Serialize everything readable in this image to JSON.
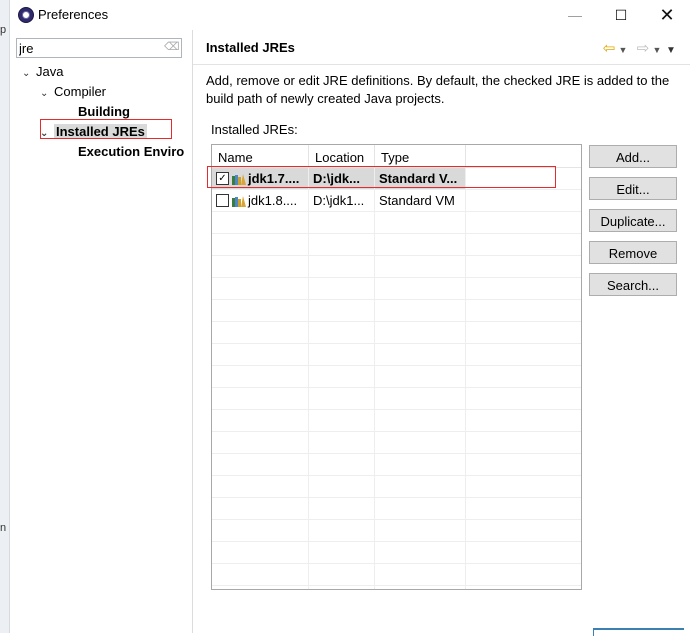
{
  "window": {
    "title": "Preferences",
    "minimize_glyph": "—",
    "maximize_glyph": "☐",
    "close_glyph": "✕"
  },
  "edge": {
    "char1": "p",
    "char2": "n"
  },
  "filter": {
    "value": "jre"
  },
  "tree": {
    "java": "Java",
    "compiler": "Compiler",
    "building": "Building",
    "installed_jres": "Installed JREs",
    "execution_env": "Execution Enviro"
  },
  "page": {
    "title": "Installed JREs",
    "description": "Add, remove or edit JRE definitions. By default, the checked JRE is added to the build path of newly created Java projects.",
    "list_label": "Installed JREs:"
  },
  "table": {
    "headers": [
      "Name",
      "Location",
      "Type"
    ],
    "rows": [
      {
        "name": "jdk1.7....",
        "location": "D:\\jdk...",
        "type": "Standard V...",
        "checked": true
      },
      {
        "name": "jdk1.8....",
        "location": "D:\\jdk1...",
        "type": "Standard VM",
        "checked": false
      }
    ]
  },
  "buttons": {
    "add": "Add...",
    "edit": "Edit...",
    "duplicate": "Duplicate...",
    "remove": "Remove",
    "search": "Search..."
  },
  "icons": {
    "back": "arrow-left-icon",
    "forward": "arrow-right-icon",
    "menu": "chevron-down-icon",
    "jre": "jre-library-icon",
    "clear": "clear-filter-icon"
  },
  "colors": {
    "highlight_box": "#e52b2b",
    "selection": "#d9d9d9",
    "back_arrow": "#e0a800"
  }
}
